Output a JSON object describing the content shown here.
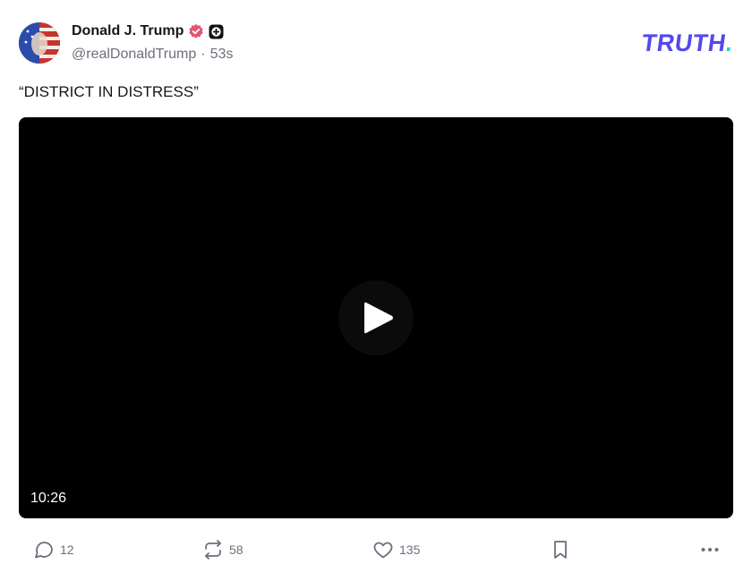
{
  "post": {
    "author": {
      "display_name": "Donald J. Trump",
      "handle": "@realDonaldTrump",
      "time_ago": "53s",
      "separator": "·"
    },
    "brand": {
      "text": "TRUTH",
      "dot": "."
    },
    "status_text": "“DISTRICT IN DISTRESS”",
    "video": {
      "duration": "10:26"
    },
    "actions": {
      "replies": "12",
      "retruths": "58",
      "likes": "135"
    },
    "colors": {
      "brand_purple": "#5448ee",
      "brand_teal": "#2fd1c2",
      "verified_pink": "#e2566f",
      "muted_text": "#6f6d7c"
    }
  }
}
